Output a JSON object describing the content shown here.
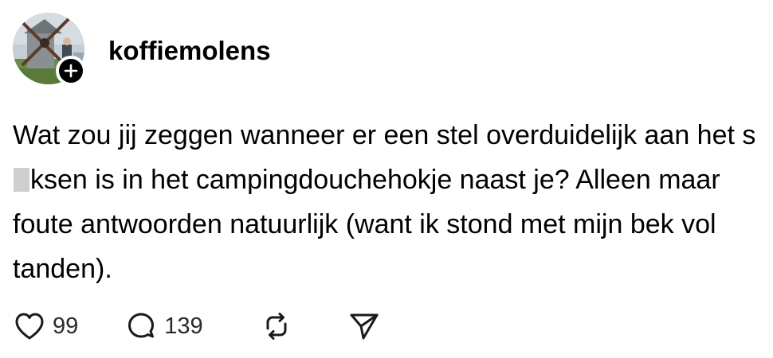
{
  "post": {
    "username": "koffiemolens",
    "text_before_censor": "Wat zou jij zeggen wanneer er een stel overduidelijk aan het s",
    "text_after_censor": "ksen is in het campingdouchehokje naast je? Alleen maar foute antwoorden natuurlijk (want ik stond met mijn bek vol tanden).",
    "likes": "99",
    "replies": "139"
  },
  "icons": {
    "avatar": "windmill-photo",
    "follow": "plus-icon",
    "like": "heart-icon",
    "reply": "speech-bubble-icon",
    "repost": "repost-icon",
    "share": "paper-plane-icon"
  },
  "colors": {
    "text": "#000000",
    "count": "#2b2b2b",
    "censor": "#cfcfcf"
  }
}
